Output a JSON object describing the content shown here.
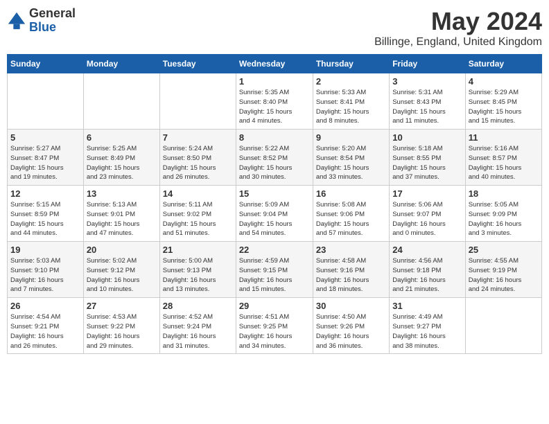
{
  "logo": {
    "general": "General",
    "blue": "Blue"
  },
  "header": {
    "month_title": "May 2024",
    "location": "Billinge, England, United Kingdom"
  },
  "days_of_week": [
    "Sunday",
    "Monday",
    "Tuesday",
    "Wednesday",
    "Thursday",
    "Friday",
    "Saturday"
  ],
  "weeks": [
    [
      {
        "day": "",
        "info": ""
      },
      {
        "day": "",
        "info": ""
      },
      {
        "day": "",
        "info": ""
      },
      {
        "day": "1",
        "info": "Sunrise: 5:35 AM\nSunset: 8:40 PM\nDaylight: 15 hours\nand 4 minutes."
      },
      {
        "day": "2",
        "info": "Sunrise: 5:33 AM\nSunset: 8:41 PM\nDaylight: 15 hours\nand 8 minutes."
      },
      {
        "day": "3",
        "info": "Sunrise: 5:31 AM\nSunset: 8:43 PM\nDaylight: 15 hours\nand 11 minutes."
      },
      {
        "day": "4",
        "info": "Sunrise: 5:29 AM\nSunset: 8:45 PM\nDaylight: 15 hours\nand 15 minutes."
      }
    ],
    [
      {
        "day": "5",
        "info": "Sunrise: 5:27 AM\nSunset: 8:47 PM\nDaylight: 15 hours\nand 19 minutes."
      },
      {
        "day": "6",
        "info": "Sunrise: 5:25 AM\nSunset: 8:49 PM\nDaylight: 15 hours\nand 23 minutes."
      },
      {
        "day": "7",
        "info": "Sunrise: 5:24 AM\nSunset: 8:50 PM\nDaylight: 15 hours\nand 26 minutes."
      },
      {
        "day": "8",
        "info": "Sunrise: 5:22 AM\nSunset: 8:52 PM\nDaylight: 15 hours\nand 30 minutes."
      },
      {
        "day": "9",
        "info": "Sunrise: 5:20 AM\nSunset: 8:54 PM\nDaylight: 15 hours\nand 33 minutes."
      },
      {
        "day": "10",
        "info": "Sunrise: 5:18 AM\nSunset: 8:55 PM\nDaylight: 15 hours\nand 37 minutes."
      },
      {
        "day": "11",
        "info": "Sunrise: 5:16 AM\nSunset: 8:57 PM\nDaylight: 15 hours\nand 40 minutes."
      }
    ],
    [
      {
        "day": "12",
        "info": "Sunrise: 5:15 AM\nSunset: 8:59 PM\nDaylight: 15 hours\nand 44 minutes."
      },
      {
        "day": "13",
        "info": "Sunrise: 5:13 AM\nSunset: 9:01 PM\nDaylight: 15 hours\nand 47 minutes."
      },
      {
        "day": "14",
        "info": "Sunrise: 5:11 AM\nSunset: 9:02 PM\nDaylight: 15 hours\nand 51 minutes."
      },
      {
        "day": "15",
        "info": "Sunrise: 5:09 AM\nSunset: 9:04 PM\nDaylight: 15 hours\nand 54 minutes."
      },
      {
        "day": "16",
        "info": "Sunrise: 5:08 AM\nSunset: 9:06 PM\nDaylight: 15 hours\nand 57 minutes."
      },
      {
        "day": "17",
        "info": "Sunrise: 5:06 AM\nSunset: 9:07 PM\nDaylight: 16 hours\nand 0 minutes."
      },
      {
        "day": "18",
        "info": "Sunrise: 5:05 AM\nSunset: 9:09 PM\nDaylight: 16 hours\nand 3 minutes."
      }
    ],
    [
      {
        "day": "19",
        "info": "Sunrise: 5:03 AM\nSunset: 9:10 PM\nDaylight: 16 hours\nand 7 minutes."
      },
      {
        "day": "20",
        "info": "Sunrise: 5:02 AM\nSunset: 9:12 PM\nDaylight: 16 hours\nand 10 minutes."
      },
      {
        "day": "21",
        "info": "Sunrise: 5:00 AM\nSunset: 9:13 PM\nDaylight: 16 hours\nand 13 minutes."
      },
      {
        "day": "22",
        "info": "Sunrise: 4:59 AM\nSunset: 9:15 PM\nDaylight: 16 hours\nand 15 minutes."
      },
      {
        "day": "23",
        "info": "Sunrise: 4:58 AM\nSunset: 9:16 PM\nDaylight: 16 hours\nand 18 minutes."
      },
      {
        "day": "24",
        "info": "Sunrise: 4:56 AM\nSunset: 9:18 PM\nDaylight: 16 hours\nand 21 minutes."
      },
      {
        "day": "25",
        "info": "Sunrise: 4:55 AM\nSunset: 9:19 PM\nDaylight: 16 hours\nand 24 minutes."
      }
    ],
    [
      {
        "day": "26",
        "info": "Sunrise: 4:54 AM\nSunset: 9:21 PM\nDaylight: 16 hours\nand 26 minutes."
      },
      {
        "day": "27",
        "info": "Sunrise: 4:53 AM\nSunset: 9:22 PM\nDaylight: 16 hours\nand 29 minutes."
      },
      {
        "day": "28",
        "info": "Sunrise: 4:52 AM\nSunset: 9:24 PM\nDaylight: 16 hours\nand 31 minutes."
      },
      {
        "day": "29",
        "info": "Sunrise: 4:51 AM\nSunset: 9:25 PM\nDaylight: 16 hours\nand 34 minutes."
      },
      {
        "day": "30",
        "info": "Sunrise: 4:50 AM\nSunset: 9:26 PM\nDaylight: 16 hours\nand 36 minutes."
      },
      {
        "day": "31",
        "info": "Sunrise: 4:49 AM\nSunset: 9:27 PM\nDaylight: 16 hours\nand 38 minutes."
      },
      {
        "day": "",
        "info": ""
      }
    ]
  ]
}
